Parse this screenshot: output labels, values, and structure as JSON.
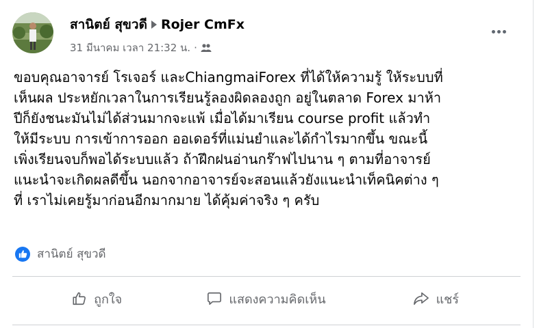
{
  "post": {
    "author": "สานิตย์ สุขวดี",
    "group": "Rojer CmFx",
    "timestamp": "31 มีนาคม เวลา 21:32 น.",
    "separator": "·",
    "audience_icon": "group-icon",
    "more_icon": "more-options-icon",
    "body_lines": [
      "ขอบคุณอาจารย์ โรเจอร์ และChiangmaiForex ที่ได้ให้ความรู้ ให้ระบบที่",
      "เห็นผล ประหยักเวลาในการเรียนรู้ลองผิดลองถูก อยู่ในตลาด Forex มาห้า",
      "ปีก็ยังชนะมันไม่ได้ส่วนมากจะแพ้ เมื่อได้มาเรียน course profit แล้วทำ",
      "ให้มีระบบ การเข้าการออก ออเดอร์ที่แม่นยำและได้กำไรมากขึ้น ขณะนี้",
      "เพิ่งเรียนจบก็พอได้ระบบแล้ว ถ้าฝึกฝนอ่านกร๊าฟไปนาน ๆ ตามที่อาจารย์",
      "แนะนำจะเกิดผลดีขึ้น นอกจากอาจารย์จะสอนแล้วยังแนะนำเท็คนิคต่าง ๆ",
      "ที่ เราไม่เคยรู้มาก่อนอีกมากมาย ได้คุ้มค่าจริง ๆ ครับ"
    ]
  },
  "reactions": {
    "icon": "like-icon",
    "names": "สานิตย์ สุขวดี"
  },
  "actions": {
    "like": {
      "label": "ถูกใจ",
      "icon": "thumbs-up-icon"
    },
    "comment": {
      "label": "แสดงความคิดเห็น",
      "icon": "comment-bubble-icon"
    },
    "share": {
      "label": "แชร์",
      "icon": "share-arrow-icon"
    }
  },
  "colors": {
    "accent": "#1877f2",
    "secondary_text": "#65676b",
    "primary_text": "#050505",
    "divider": "#ced0d4"
  }
}
